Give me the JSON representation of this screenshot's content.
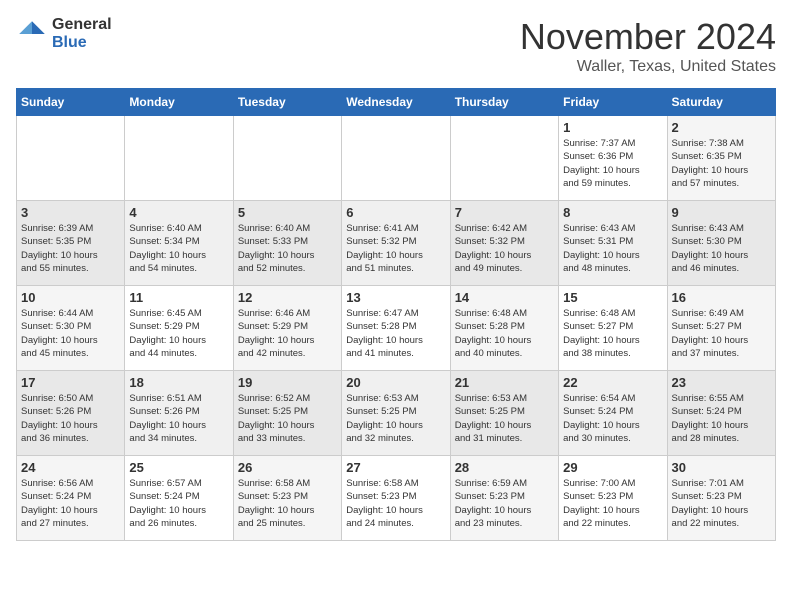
{
  "header": {
    "logo_general": "General",
    "logo_blue": "Blue",
    "month_title": "November 2024",
    "location": "Waller, Texas, United States"
  },
  "weekdays": [
    "Sunday",
    "Monday",
    "Tuesday",
    "Wednesday",
    "Thursday",
    "Friday",
    "Saturday"
  ],
  "weeks": [
    [
      {
        "day": "",
        "info": ""
      },
      {
        "day": "",
        "info": ""
      },
      {
        "day": "",
        "info": ""
      },
      {
        "day": "",
        "info": ""
      },
      {
        "day": "",
        "info": ""
      },
      {
        "day": "1",
        "info": "Sunrise: 7:37 AM\nSunset: 6:36 PM\nDaylight: 10 hours\nand 59 minutes."
      },
      {
        "day": "2",
        "info": "Sunrise: 7:38 AM\nSunset: 6:35 PM\nDaylight: 10 hours\nand 57 minutes."
      }
    ],
    [
      {
        "day": "3",
        "info": "Sunrise: 6:39 AM\nSunset: 5:35 PM\nDaylight: 10 hours\nand 55 minutes."
      },
      {
        "day": "4",
        "info": "Sunrise: 6:40 AM\nSunset: 5:34 PM\nDaylight: 10 hours\nand 54 minutes."
      },
      {
        "day": "5",
        "info": "Sunrise: 6:40 AM\nSunset: 5:33 PM\nDaylight: 10 hours\nand 52 minutes."
      },
      {
        "day": "6",
        "info": "Sunrise: 6:41 AM\nSunset: 5:32 PM\nDaylight: 10 hours\nand 51 minutes."
      },
      {
        "day": "7",
        "info": "Sunrise: 6:42 AM\nSunset: 5:32 PM\nDaylight: 10 hours\nand 49 minutes."
      },
      {
        "day": "8",
        "info": "Sunrise: 6:43 AM\nSunset: 5:31 PM\nDaylight: 10 hours\nand 48 minutes."
      },
      {
        "day": "9",
        "info": "Sunrise: 6:43 AM\nSunset: 5:30 PM\nDaylight: 10 hours\nand 46 minutes."
      }
    ],
    [
      {
        "day": "10",
        "info": "Sunrise: 6:44 AM\nSunset: 5:30 PM\nDaylight: 10 hours\nand 45 minutes."
      },
      {
        "day": "11",
        "info": "Sunrise: 6:45 AM\nSunset: 5:29 PM\nDaylight: 10 hours\nand 44 minutes."
      },
      {
        "day": "12",
        "info": "Sunrise: 6:46 AM\nSunset: 5:29 PM\nDaylight: 10 hours\nand 42 minutes."
      },
      {
        "day": "13",
        "info": "Sunrise: 6:47 AM\nSunset: 5:28 PM\nDaylight: 10 hours\nand 41 minutes."
      },
      {
        "day": "14",
        "info": "Sunrise: 6:48 AM\nSunset: 5:28 PM\nDaylight: 10 hours\nand 40 minutes."
      },
      {
        "day": "15",
        "info": "Sunrise: 6:48 AM\nSunset: 5:27 PM\nDaylight: 10 hours\nand 38 minutes."
      },
      {
        "day": "16",
        "info": "Sunrise: 6:49 AM\nSunset: 5:27 PM\nDaylight: 10 hours\nand 37 minutes."
      }
    ],
    [
      {
        "day": "17",
        "info": "Sunrise: 6:50 AM\nSunset: 5:26 PM\nDaylight: 10 hours\nand 36 minutes."
      },
      {
        "day": "18",
        "info": "Sunrise: 6:51 AM\nSunset: 5:26 PM\nDaylight: 10 hours\nand 34 minutes."
      },
      {
        "day": "19",
        "info": "Sunrise: 6:52 AM\nSunset: 5:25 PM\nDaylight: 10 hours\nand 33 minutes."
      },
      {
        "day": "20",
        "info": "Sunrise: 6:53 AM\nSunset: 5:25 PM\nDaylight: 10 hours\nand 32 minutes."
      },
      {
        "day": "21",
        "info": "Sunrise: 6:53 AM\nSunset: 5:25 PM\nDaylight: 10 hours\nand 31 minutes."
      },
      {
        "day": "22",
        "info": "Sunrise: 6:54 AM\nSunset: 5:24 PM\nDaylight: 10 hours\nand 30 minutes."
      },
      {
        "day": "23",
        "info": "Sunrise: 6:55 AM\nSunset: 5:24 PM\nDaylight: 10 hours\nand 28 minutes."
      }
    ],
    [
      {
        "day": "24",
        "info": "Sunrise: 6:56 AM\nSunset: 5:24 PM\nDaylight: 10 hours\nand 27 minutes."
      },
      {
        "day": "25",
        "info": "Sunrise: 6:57 AM\nSunset: 5:24 PM\nDaylight: 10 hours\nand 26 minutes."
      },
      {
        "day": "26",
        "info": "Sunrise: 6:58 AM\nSunset: 5:23 PM\nDaylight: 10 hours\nand 25 minutes."
      },
      {
        "day": "27",
        "info": "Sunrise: 6:58 AM\nSunset: 5:23 PM\nDaylight: 10 hours\nand 24 minutes."
      },
      {
        "day": "28",
        "info": "Sunrise: 6:59 AM\nSunset: 5:23 PM\nDaylight: 10 hours\nand 23 minutes."
      },
      {
        "day": "29",
        "info": "Sunrise: 7:00 AM\nSunset: 5:23 PM\nDaylight: 10 hours\nand 22 minutes."
      },
      {
        "day": "30",
        "info": "Sunrise: 7:01 AM\nSunset: 5:23 PM\nDaylight: 10 hours\nand 22 minutes."
      }
    ]
  ]
}
